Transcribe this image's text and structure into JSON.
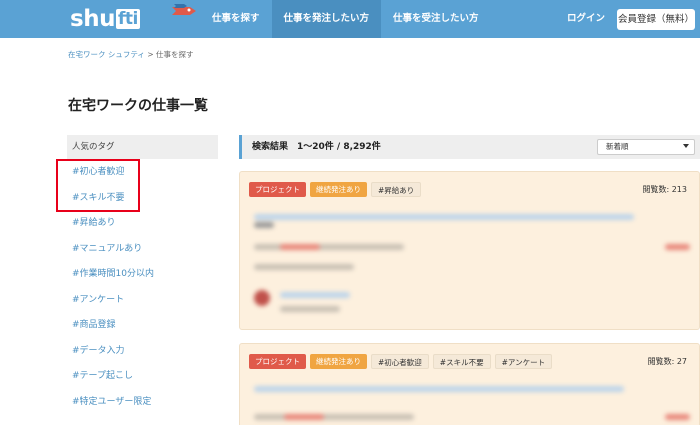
{
  "header": {
    "logo_text": "shu",
    "logo_box": "fti",
    "nav": [
      "仕事を探す",
      "仕事を発注したい方",
      "仕事を受注したい方"
    ],
    "login": "ログイン",
    "register": "会員登録（無料）"
  },
  "breadcrumb": {
    "home": "在宅ワーク シュフティ",
    "sep": " > ",
    "current": "仕事を探す"
  },
  "page_title": "在宅ワークの仕事一覧",
  "sidebar": {
    "heading": "人気のタグ",
    "tags": [
      "#初心者歓迎",
      "#スキル不要",
      "#昇給あり",
      "#マニュアルあり",
      "#作業時間10分以内",
      "#アンケート",
      "#商品登録",
      "#データ入力",
      "#テープ起こし",
      "#特定ユーザー限定"
    ]
  },
  "results": {
    "label": "検索結果　1〜20件 / 8,292件",
    "sort": "新着順"
  },
  "cards": [
    {
      "badges": [
        "プロジェクト",
        "継続発注あり"
      ],
      "tags": [
        "#昇給あり"
      ],
      "views": "閲覧数: 213"
    },
    {
      "badges": [
        "プロジェクト",
        "継続発注あり"
      ],
      "tags": [
        "#初心者歓迎",
        "#スキル不要",
        "#アンケート"
      ],
      "views": "閲覧数: 27"
    }
  ],
  "colors": {
    "header": "#5aa2d4",
    "highlight": "#e8001a",
    "card_bg": "#fdf0de",
    "project": "#e05a4a",
    "continue": "#f0a542"
  }
}
